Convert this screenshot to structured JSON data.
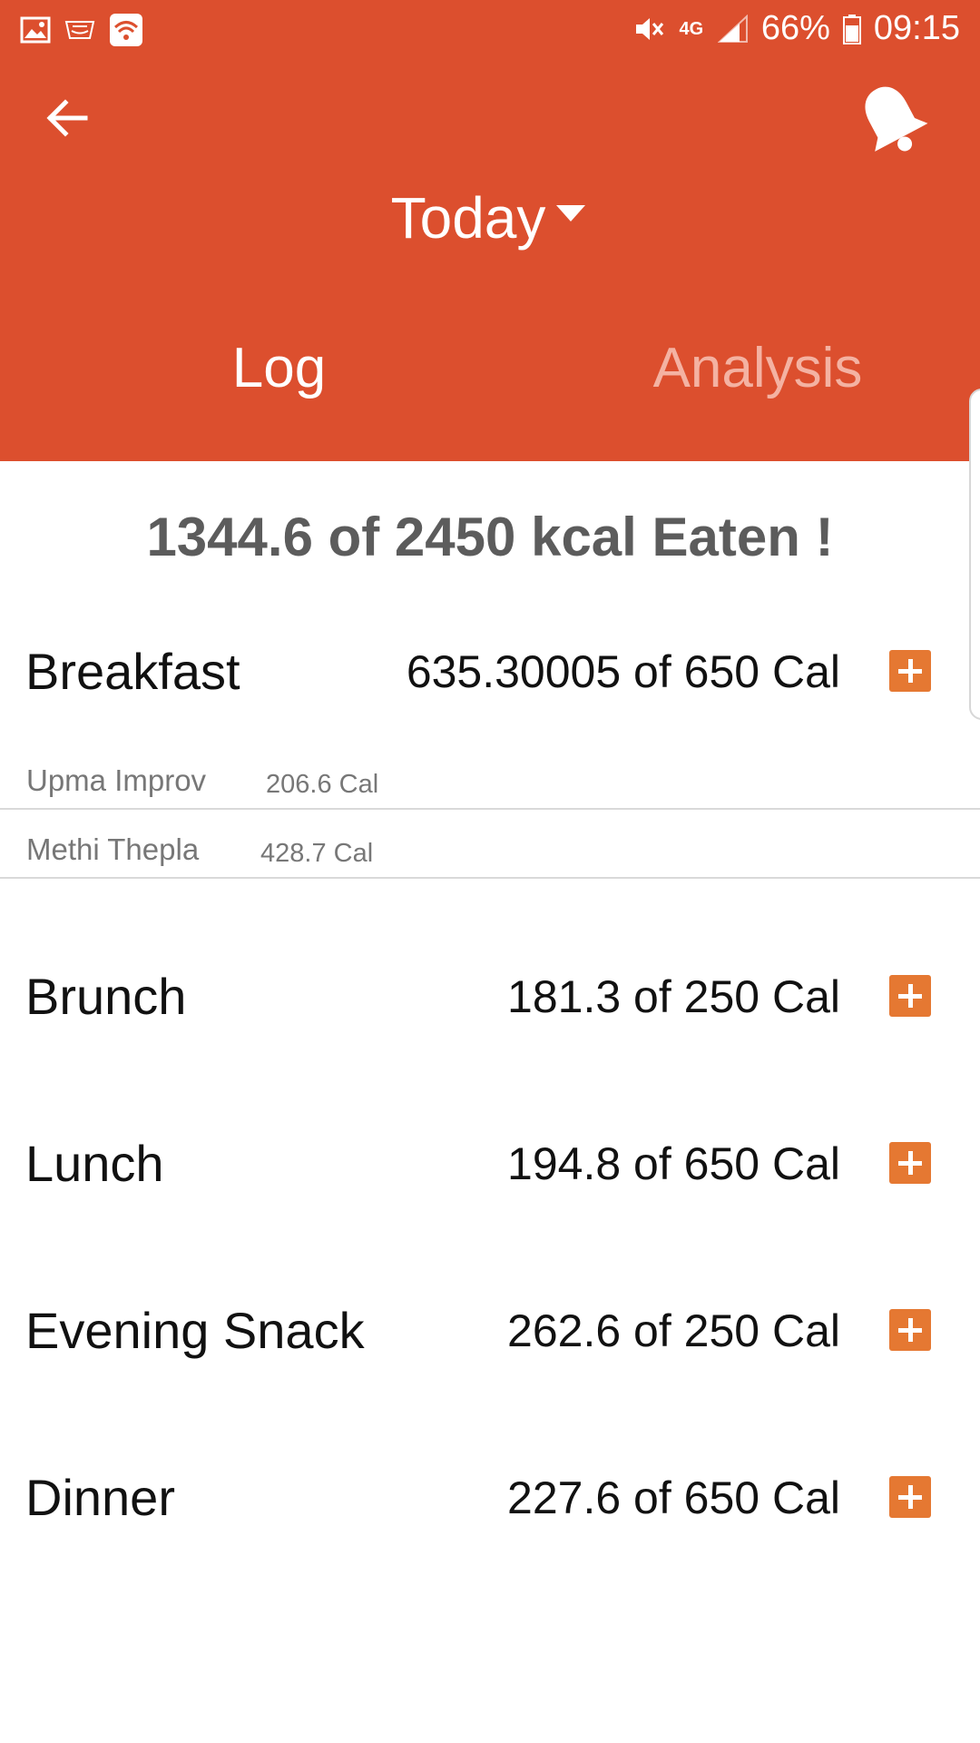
{
  "status_bar": {
    "network_label": "4G",
    "battery_percent": "66%",
    "time": "09:15",
    "icons": [
      "gallery-icon",
      "amazon-icon",
      "wifi-icon",
      "mute-icon",
      "signal-icon",
      "battery-icon"
    ]
  },
  "header": {
    "date_label": "Today",
    "tabs": [
      {
        "label": "Log",
        "active": true
      },
      {
        "label": "Analysis",
        "active": false
      }
    ],
    "accent_color": "#dc4f2e"
  },
  "summary": {
    "text": "1344.6 of 2450 kcal Eaten !"
  },
  "meals": [
    {
      "name": "Breakfast",
      "calories": "635.30005 of 650 Cal",
      "items": [
        {
          "name": "Upma Improv",
          "calories": "206.6 Cal"
        },
        {
          "name": "Methi Thepla",
          "calories": "428.7 Cal"
        }
      ]
    },
    {
      "name": "Brunch",
      "calories": "181.3 of 250 Cal",
      "items": []
    },
    {
      "name": "Lunch",
      "calories": "194.8 of 650 Cal",
      "items": []
    },
    {
      "name": "Evening Snack",
      "calories": "262.6 of 250 Cal",
      "items": []
    },
    {
      "name": "Dinner",
      "calories": "227.6 of 650 Cal",
      "items": []
    }
  ],
  "add_button_color": "#e57832"
}
